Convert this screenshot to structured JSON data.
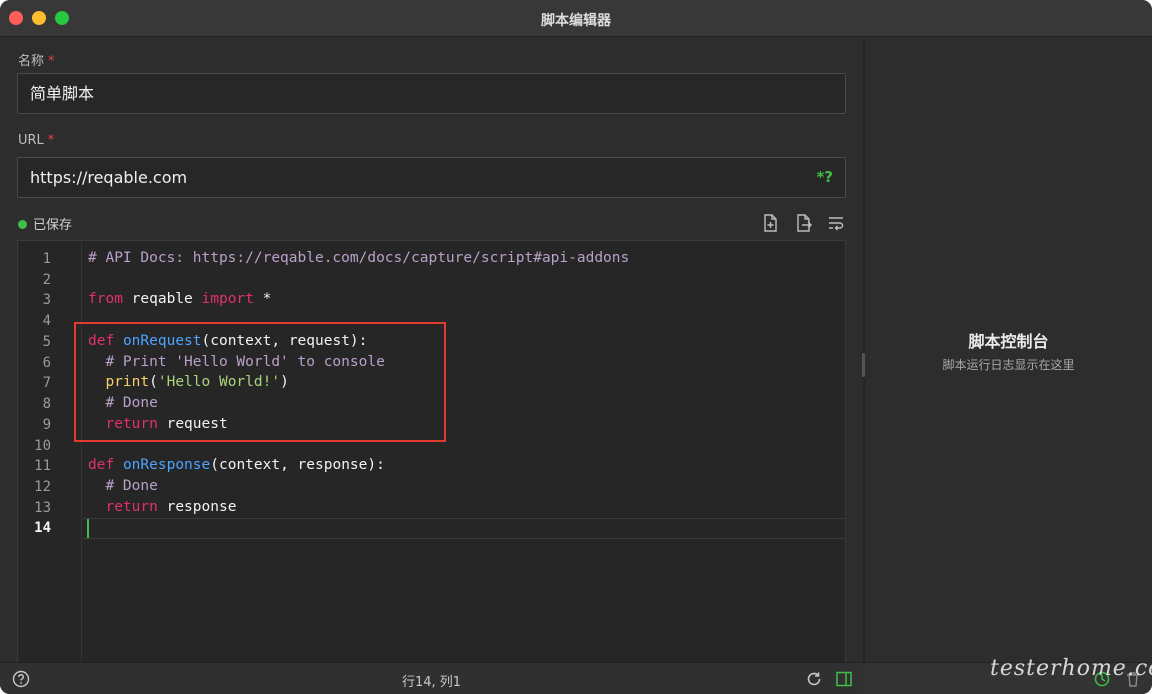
{
  "window": {
    "title": "脚本编辑器"
  },
  "form": {
    "name_label": "名称",
    "name_value": "简单脚本",
    "url_label": "URL",
    "url_value": "https://reqable.com",
    "required_mark": "*",
    "regex_toggle": "*?"
  },
  "status": {
    "saved_text": "已保存"
  },
  "editor": {
    "line_numbers": [
      "1",
      "2",
      "3",
      "4",
      "5",
      "6",
      "7",
      "8",
      "9",
      "10",
      "11",
      "12",
      "13",
      "14"
    ],
    "active_line": "14",
    "lines": {
      "l1": "# API Docs: https://reqable.com/docs/capture/script#api-addons",
      "l3_kw1": "from",
      "l3_mod": " reqable ",
      "l3_kw2": "import",
      "l3_rest": " *",
      "l5_kw": "def",
      "l5_fn": "onRequest",
      "l5_rest": "(context, request):",
      "l6": "  # Print 'Hello World' to console",
      "l7_fn": "print",
      "l7_open": "(",
      "l7_str": "'Hello World!'",
      "l7_close": ")",
      "l8": "  # Done",
      "l9_kw": "return",
      "l9_rest": " request",
      "l11_kw": "def",
      "l11_fn": "onResponse",
      "l11_rest": "(context, response):",
      "l12": "  # Done",
      "l13_kw": "return",
      "l13_rest": " response"
    }
  },
  "console": {
    "title": "脚本控制台",
    "subtitle": "脚本运行日志显示在这里"
  },
  "statusbar": {
    "cursor_position": "行14, 列1"
  },
  "watermark": "testerhome.com",
  "colors": {
    "accent_green": "#3fbf4a",
    "highlight_red": "#e33b2f",
    "keyword": "#e0306e",
    "function": "#4da3ff"
  }
}
